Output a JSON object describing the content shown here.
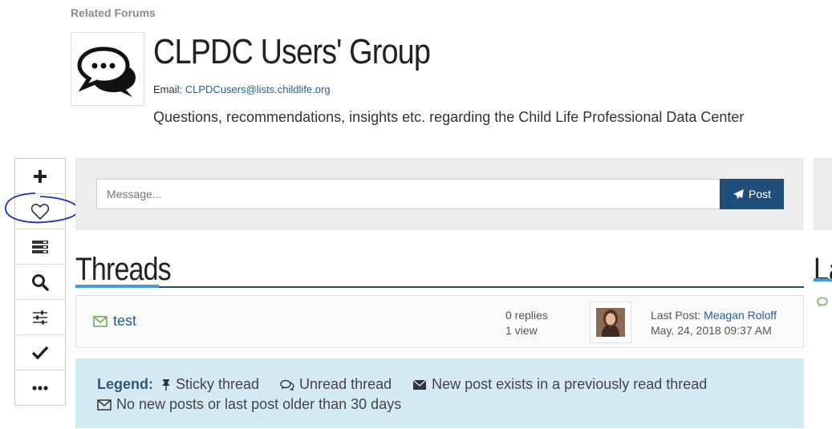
{
  "related_forums_label": "Related Forums",
  "forum": {
    "title": "CLPDC Users' Group",
    "email_label": "Email:",
    "email": "CLPDCusers@lists.childlife.org",
    "description": "Questions, recommendations, insights etc. regarding the Child Life Professional Data Center",
    "icon": "speech-bubbles-icon"
  },
  "toolbar": {
    "items": [
      {
        "name": "add-icon"
      },
      {
        "name": "heart-icon"
      },
      {
        "name": "list-icon"
      },
      {
        "name": "search-icon"
      },
      {
        "name": "sliders-icon"
      },
      {
        "name": "checkmark-icon"
      },
      {
        "name": "more-icon"
      }
    ]
  },
  "composer": {
    "placeholder": "Message...",
    "post_label": "Post"
  },
  "threads": {
    "heading": "Threads",
    "items": [
      {
        "title": "test",
        "replies": "0 replies",
        "views": "1 view",
        "last_post_label": "Last Post:",
        "last_post_author": "Meagan Roloff",
        "last_post_date": "May. 24, 2018 09:37 AM"
      }
    ]
  },
  "side_heading": "La",
  "legend": {
    "title": "Legend:",
    "sticky": "Sticky thread",
    "unread": "Unread thread",
    "new_post": "New post exists in a previously read thread",
    "no_new": "No new posts or last post older than 30 days"
  },
  "colors": {
    "brand_blue": "#1f4e79",
    "accent_blue": "#3da2d1",
    "link_blue": "#1f5f99",
    "legend_bg": "#d4ebf5",
    "annotation_circle": "#1d2fc0"
  }
}
